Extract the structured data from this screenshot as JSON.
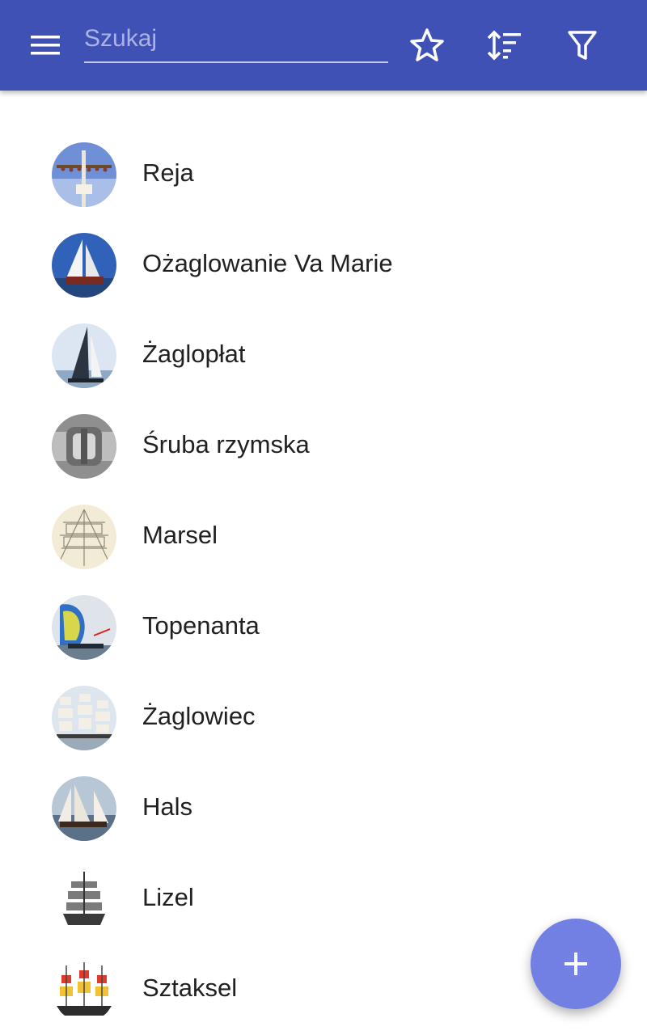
{
  "toolbar": {
    "menu_icon": "menu-icon",
    "search_placeholder": "Szukaj",
    "search_value": "",
    "favorites_icon": "star-outline-icon",
    "sort_icon": "sort-icon",
    "filter_icon": "filter-icon",
    "color": "#3f51b5"
  },
  "items": [
    {
      "label": "Reja",
      "thumbnail": "yard-with-sailors"
    },
    {
      "label": "Ożaglowanie Va Marie",
      "thumbnail": "schooner-blue-sky"
    },
    {
      "label": "Żaglopłat",
      "thumbnail": "racing-yacht-sail"
    },
    {
      "label": "Śruba rzymska",
      "thumbnail": "turnbuckle-closeup"
    },
    {
      "label": "Marsel",
      "thumbnail": "rigging-sketch"
    },
    {
      "label": "Topenanta",
      "thumbnail": "spinnaker-yacht"
    },
    {
      "label": "Żaglowiec",
      "thumbnail": "tall-ships"
    },
    {
      "label": "Hals",
      "thumbnail": "schooner-at-sea"
    },
    {
      "label": "Lizel",
      "thumbnail": "square-rigger-drawing"
    },
    {
      "label": "Sztaksel",
      "thumbnail": "ship-flags-drawing"
    }
  ],
  "fab": {
    "icon": "plus-icon",
    "color": "#7380e3"
  }
}
